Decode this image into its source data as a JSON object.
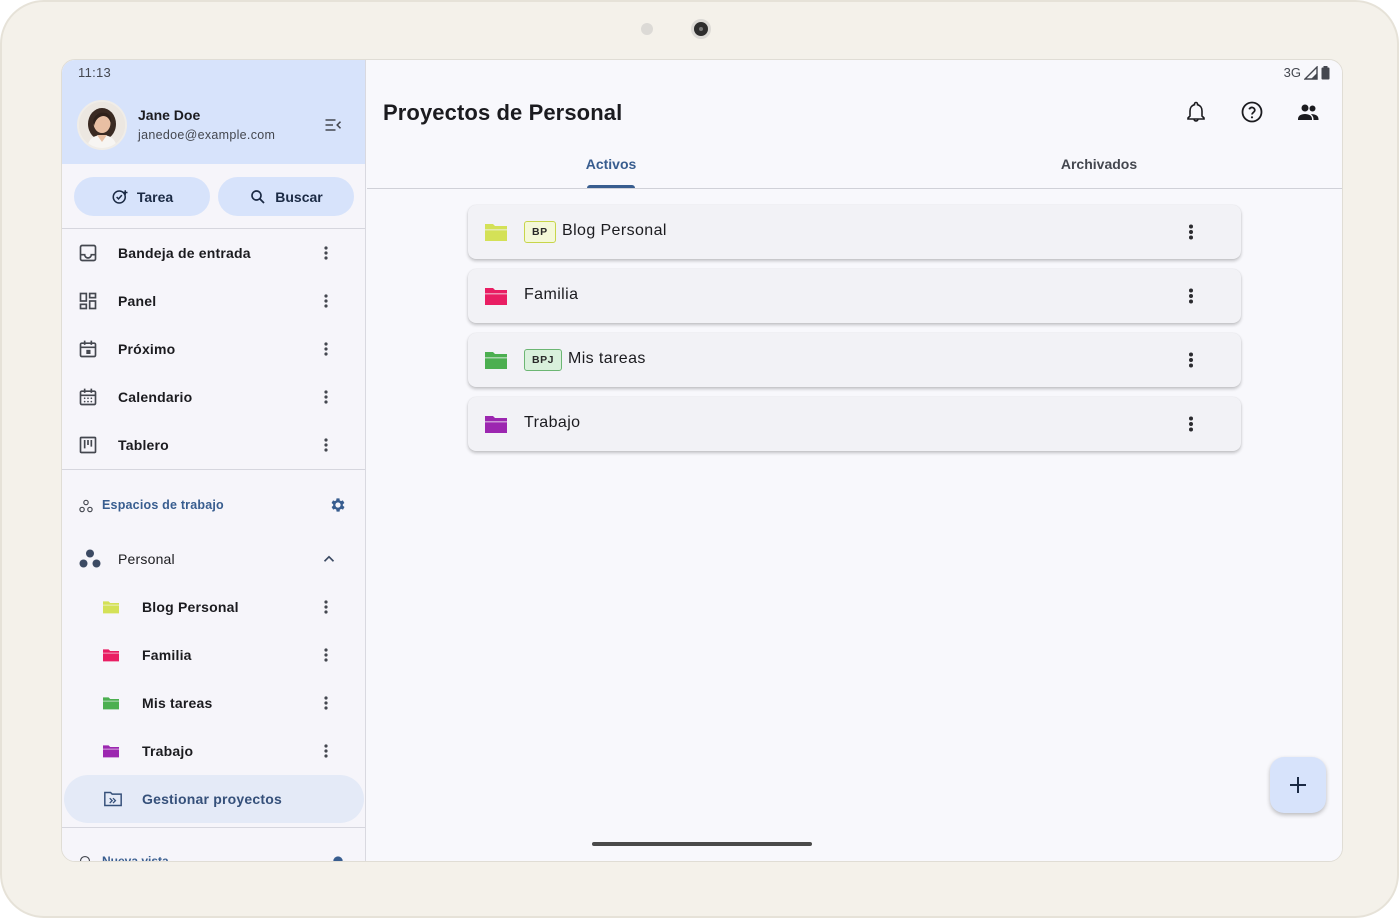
{
  "status": {
    "time": "11:13",
    "network": "3G"
  },
  "user": {
    "name": "Jane Doe",
    "email": "janedoe@example.com"
  },
  "sidebar": {
    "buttons": {
      "task": "Tarea",
      "search": "Buscar"
    },
    "nav": [
      {
        "label": "Bandeja de entrada",
        "icon": "inbox-icon"
      },
      {
        "label": "Panel",
        "icon": "dashboard-icon"
      },
      {
        "label": "Próximo",
        "icon": "upcoming-icon"
      },
      {
        "label": "Calendario",
        "icon": "calendar-icon"
      },
      {
        "label": "Tablero",
        "icon": "board-icon"
      }
    ],
    "workspaces_header": "Espacios de trabajo",
    "workspace": {
      "name": "Personal",
      "expanded": true
    },
    "projects": [
      {
        "label": "Blog Personal",
        "color": "#d4e157"
      },
      {
        "label": "Familia",
        "color": "#e91e63"
      },
      {
        "label": "Mis tareas",
        "color": "#4caf50"
      },
      {
        "label": "Trabajo",
        "color": "#9c27b0"
      }
    ],
    "manage_projects": "Gestionar proyectos",
    "partial_section": "Nueva vista"
  },
  "main": {
    "title": "Proyectos de Personal",
    "tabs": [
      {
        "label": "Activos",
        "active": true
      },
      {
        "label": "Archivados",
        "active": false
      }
    ],
    "projects": [
      {
        "name": "Blog Personal",
        "badge": "BP",
        "color": "#d4e157"
      },
      {
        "name": "Familia",
        "badge": "",
        "color": "#e91e63"
      },
      {
        "name": "Mis tareas",
        "badge": "BPJ",
        "color": "#4caf50"
      },
      {
        "name": "Trabajo",
        "badge": "",
        "color": "#9c27b0"
      }
    ],
    "fab_icon": "plus-icon"
  },
  "colors": {
    "accent": "#385d8f",
    "header_bg": "#d7e3fb"
  }
}
